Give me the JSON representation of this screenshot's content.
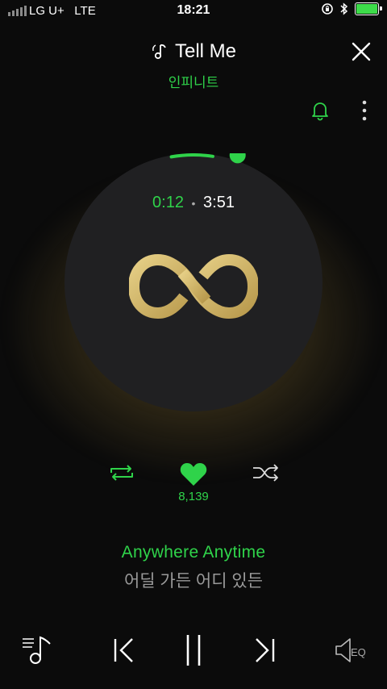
{
  "status_bar": {
    "carrier": "LG U+",
    "network": "LTE",
    "time": "18:21",
    "battery_level": 1.0
  },
  "header": {
    "song_title": "Tell Me",
    "artist": "인피니트"
  },
  "player": {
    "current_time": "0:12",
    "separator": "•",
    "total_time": "3:51",
    "progress": 0.052
  },
  "actions": {
    "like_count": "8,139"
  },
  "lyrics": {
    "current_line": "Anywhere Anytime",
    "next_line": "어딜 가든 어디 있든"
  },
  "controls": {
    "eq_label": "EQ"
  },
  "colors": {
    "accent": "#2fd34a",
    "logo_gold": "#d4b96a",
    "background": "#0b0b0b",
    "disc": "#202022"
  },
  "icons": [
    "music-note-icon",
    "close-icon",
    "bell-icon",
    "more-vertical-icon",
    "repeat-icon",
    "heart-icon",
    "shuffle-icon",
    "playlist-icon",
    "previous-icon",
    "pause-icon",
    "next-icon",
    "speaker-eq-icon"
  ]
}
